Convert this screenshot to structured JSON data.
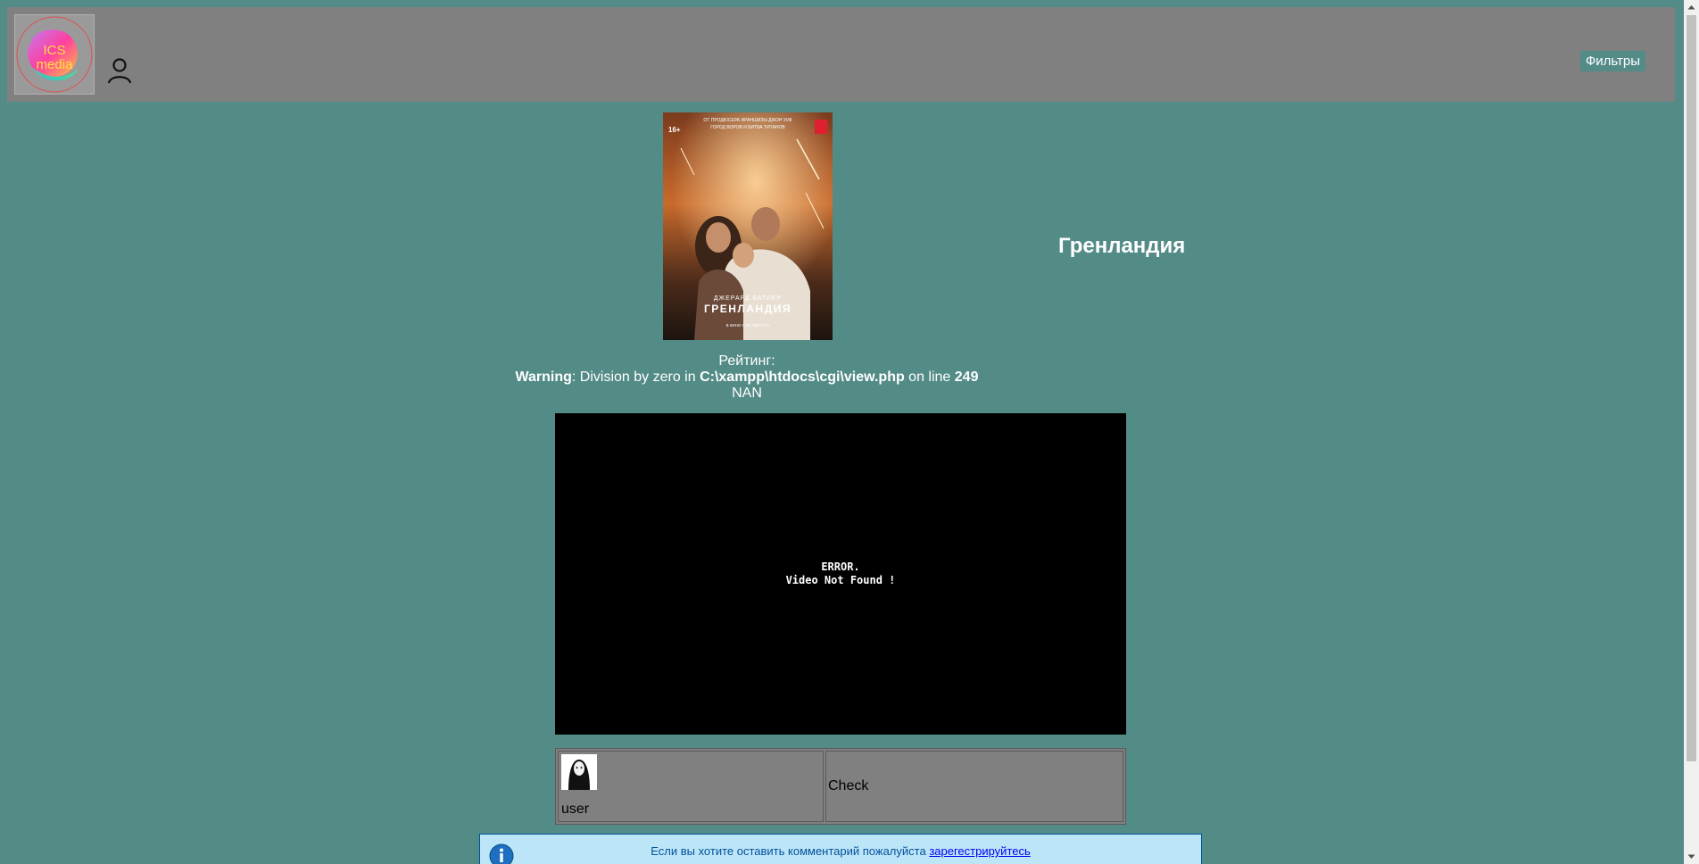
{
  "header": {
    "logo_text_line1": "ICS",
    "logo_text_line2": "media",
    "filters_label": "Фильтры"
  },
  "movie": {
    "title": "Гренландия",
    "poster": {
      "top_text_line1": "ОТ ПРОДЮСЕРА ФРАНШИЗЫ ДЖОН УИК",
      "top_text_line2": "ГОРОД ВОРОВ И БИТВА ТИТАНОВ",
      "age_rating": "16+",
      "actor": "ДЖЕРАРД БАТЛЕР",
      "title": "ГРЕНЛАНДИЯ",
      "release": "В КИНО С 20 АВГУСТА"
    }
  },
  "rating": {
    "label": "Рейтинг:",
    "warning_label": "Warning",
    "warning_msg": ": Division by zero in ",
    "warning_path": "C:\\xampp\\htdocs\\cgi\\view.php",
    "warning_on_line": " on line ",
    "warning_line_no": "249",
    "value": "NAN"
  },
  "video": {
    "error_line1": "ERROR.",
    "error_line2": "Video Not Found !"
  },
  "comments": [
    {
      "username": "user",
      "text": "Check"
    }
  ],
  "notice": {
    "text": "Если вы хотите оставить комментарий пожалуйста ",
    "link_text": "зарегестрируйтесь"
  },
  "colors": {
    "background": "#538b87",
    "header": "#808080",
    "notice_bg": "#bde5f8",
    "notice_text": "#00529b"
  }
}
